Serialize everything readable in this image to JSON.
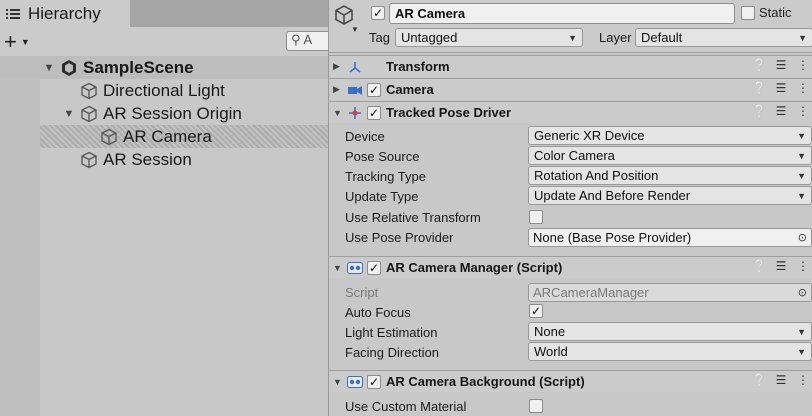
{
  "hierarchy": {
    "tab_title": "Hierarchy",
    "search_placeholder": "A",
    "items": [
      {
        "label": "SampleScene",
        "type": "scene"
      },
      {
        "label": "Directional Light"
      },
      {
        "label": "AR Session Origin"
      },
      {
        "label": "AR Camera",
        "selected": true
      },
      {
        "label": "AR Session"
      }
    ]
  },
  "inspector": {
    "object_name": "AR Camera",
    "static_label": "Static",
    "tag_label": "Tag",
    "tag_value": "Untagged",
    "layer_label": "Layer",
    "layer_value": "Default",
    "components": [
      {
        "title": "Transform"
      },
      {
        "title": "Camera"
      },
      {
        "title": "Tracked Pose Driver",
        "properties": [
          {
            "label": "Device",
            "value": "Generic XR Device"
          },
          {
            "label": "Pose Source",
            "value": "Color Camera"
          },
          {
            "label": "Tracking Type",
            "value": "Rotation And Position"
          },
          {
            "label": "Update Type",
            "value": "Update And Before Render"
          },
          {
            "label": "Use Relative Transform",
            "checked": false
          },
          {
            "label": "Use Pose Provider",
            "value": "None (Base Pose Provider)"
          }
        ]
      },
      {
        "title": "AR Camera Manager (Script)",
        "properties": [
          {
            "label": "Script",
            "value": "ARCameraManager"
          },
          {
            "label": "Auto Focus",
            "checked": true
          },
          {
            "label": "Light Estimation",
            "value": "None"
          },
          {
            "label": "Facing Direction",
            "value": "World"
          }
        ]
      },
      {
        "title": "AR Camera Background (Script)",
        "properties": [
          {
            "label": "Use Custom Material",
            "checked": false
          }
        ]
      }
    ]
  },
  "glyphs": {
    "checkmark": "✓",
    "caret": "▼",
    "fold_open": "▼",
    "fold_closed": "▶",
    "plus": "+",
    "target": "⊙"
  }
}
